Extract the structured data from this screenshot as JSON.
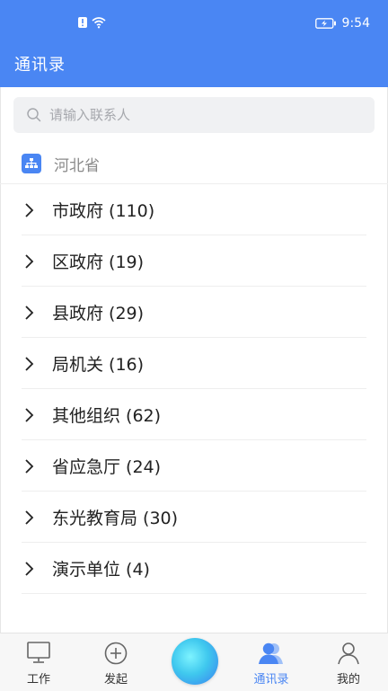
{
  "status_bar": {
    "time": "9:54"
  },
  "header": {
    "title": "通讯录"
  },
  "search": {
    "placeholder": "请输入联系人"
  },
  "org": {
    "name": "河北省"
  },
  "list": {
    "items": [
      {
        "label": "市政府 (110)"
      },
      {
        "label": "区政府 (19)"
      },
      {
        "label": "县政府 (29)"
      },
      {
        "label": "局机关 (16)"
      },
      {
        "label": "其他组织 (62)"
      },
      {
        "label": "省应急厅 (24)"
      },
      {
        "label": "东光教育局 (30)"
      },
      {
        "label": "演示单位 (4)"
      }
    ]
  },
  "tabbar": {
    "work": "工作",
    "initiate": "发起",
    "contacts": "通讯录",
    "mine": "我的"
  },
  "colors": {
    "accent": "#4a86f3"
  }
}
